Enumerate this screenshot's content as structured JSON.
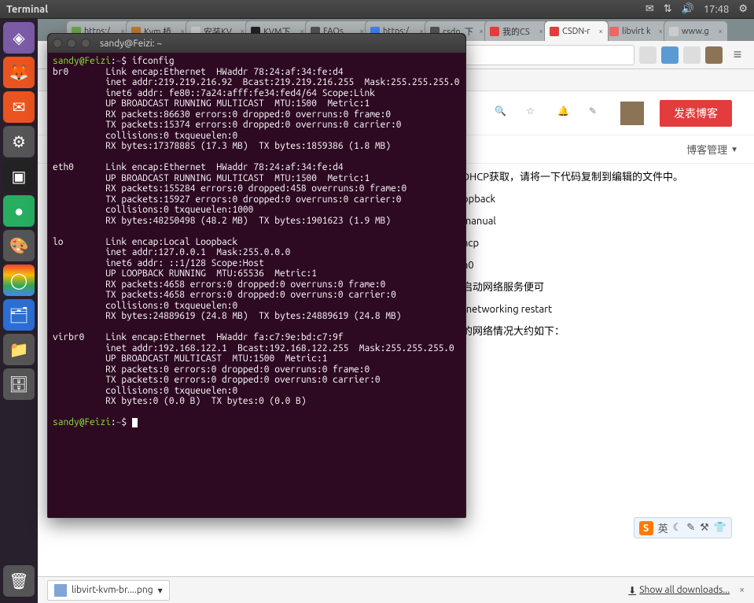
{
  "menubar": {
    "app_label": "Terminal",
    "time": "17:48"
  },
  "launcher": {
    "items": [
      "◈",
      "🦊",
      "✉",
      "⚙",
      "▣",
      "●",
      "🎨",
      "◯",
      "🗂",
      "📁",
      "🗄"
    ],
    "trash": "🗑"
  },
  "chrome": {
    "tabs": [
      {
        "title": "https:/",
        "favicon": "#6aa84f"
      },
      {
        "title": "Kvm 桥",
        "favicon": "#c27b33"
      },
      {
        "title": "安装KV",
        "favicon": "#ccc"
      },
      {
        "title": "KVM下",
        "favicon": "#222"
      },
      {
        "title": "FAQs",
        "favicon": "#555"
      },
      {
        "title": "https:/",
        "favicon": "#4285f4"
      },
      {
        "title": "csdn_下",
        "favicon": "#555"
      },
      {
        "title": "我的CS",
        "favicon": "#e33c3c"
      },
      {
        "title": "CSDN-r",
        "favicon": "#e33c3c",
        "active": true
      },
      {
        "title": "libvirt k",
        "favicon": "#e66"
      },
      {
        "title": "www.g",
        "favicon": "#ccc"
      }
    ],
    "nav_back": "←",
    "nav_fwd": "→",
    "nav_reload": "⟳",
    "nav_home": "⌂",
    "omnibox_prefix": "🔒",
    "omnibox_url": "",
    "ext_icons": 4,
    "menu": "≡"
  },
  "csdn": {
    "publish_label": "发表博客",
    "blog_mgmt": "博客管理",
    "snippets": [
      "DHCP获取，请将一下代码复制到编辑的文件中。",
      "opback",
      "manual",
      "hcp",
      "h0",
      "启动网络服务便可",
      "/networking restart",
      "的网络情况大约如下："
    ]
  },
  "sogou": {
    "logo": "S",
    "text": "英",
    "icons": [
      "☾",
      "✎",
      "⚒",
      "👕"
    ]
  },
  "dlshelf": {
    "file": "libvirt-kvm-br....png",
    "showall": "Show all downloads...",
    "arrow": "⬇"
  },
  "terminal": {
    "title": "sandy@Feizi: ~",
    "prompt_user": "sandy@Feizi",
    "prompt_path": "~",
    "command": "ifconfig",
    "output": "br0       Link encap:Ethernet  HWaddr 78:24:af:34:fe:d4\n          inet addr:219.219.216.92  Bcast:219.219.216.255  Mask:255.255.255.0\n          inet6 addr: fe80::7a24:afff:fe34:fed4/64 Scope:Link\n          UP BROADCAST RUNNING MULTICAST  MTU:1500  Metric:1\n          RX packets:86630 errors:0 dropped:0 overruns:0 frame:0\n          TX packets:15374 errors:0 dropped:0 overruns:0 carrier:0\n          collisions:0 txqueuelen:0\n          RX bytes:17378885 (17.3 MB)  TX bytes:1859386 (1.8 MB)\n\neth0      Link encap:Ethernet  HWaddr 78:24:af:34:fe:d4\n          UP BROADCAST RUNNING MULTICAST  MTU:1500  Metric:1\n          RX packets:155284 errors:0 dropped:458 overruns:0 frame:0\n          TX packets:15927 errors:0 dropped:0 overruns:0 carrier:0\n          collisions:0 txqueuelen:1000\n          RX bytes:48250498 (48.2 MB)  TX bytes:1901623 (1.9 MB)\n\nlo        Link encap:Local Loopback\n          inet addr:127.0.0.1  Mask:255.0.0.0\n          inet6 addr: ::1/128 Scope:Host\n          UP LOOPBACK RUNNING  MTU:65536  Metric:1\n          RX packets:4658 errors:0 dropped:0 overruns:0 frame:0\n          TX packets:4658 errors:0 dropped:0 overruns:0 carrier:0\n          collisions:0 txqueuelen:0\n          RX bytes:24889619 (24.8 MB)  TX bytes:24889619 (24.8 MB)\n\nvirbr0    Link encap:Ethernet  HWaddr fa:c7:9e:bd:c7:9f\n          inet addr:192.168.122.1  Bcast:192.168.122.255  Mask:255.255.255.0\n          UP BROADCAST MULTICAST  MTU:1500  Metric:1\n          RX packets:0 errors:0 dropped:0 overruns:0 frame:0\n          TX packets:0 errors:0 dropped:0 overruns:0 carrier:0\n          collisions:0 txqueuelen:0\n          RX bytes:0 (0.0 B)  TX bytes:0 (0.0 B)"
  }
}
